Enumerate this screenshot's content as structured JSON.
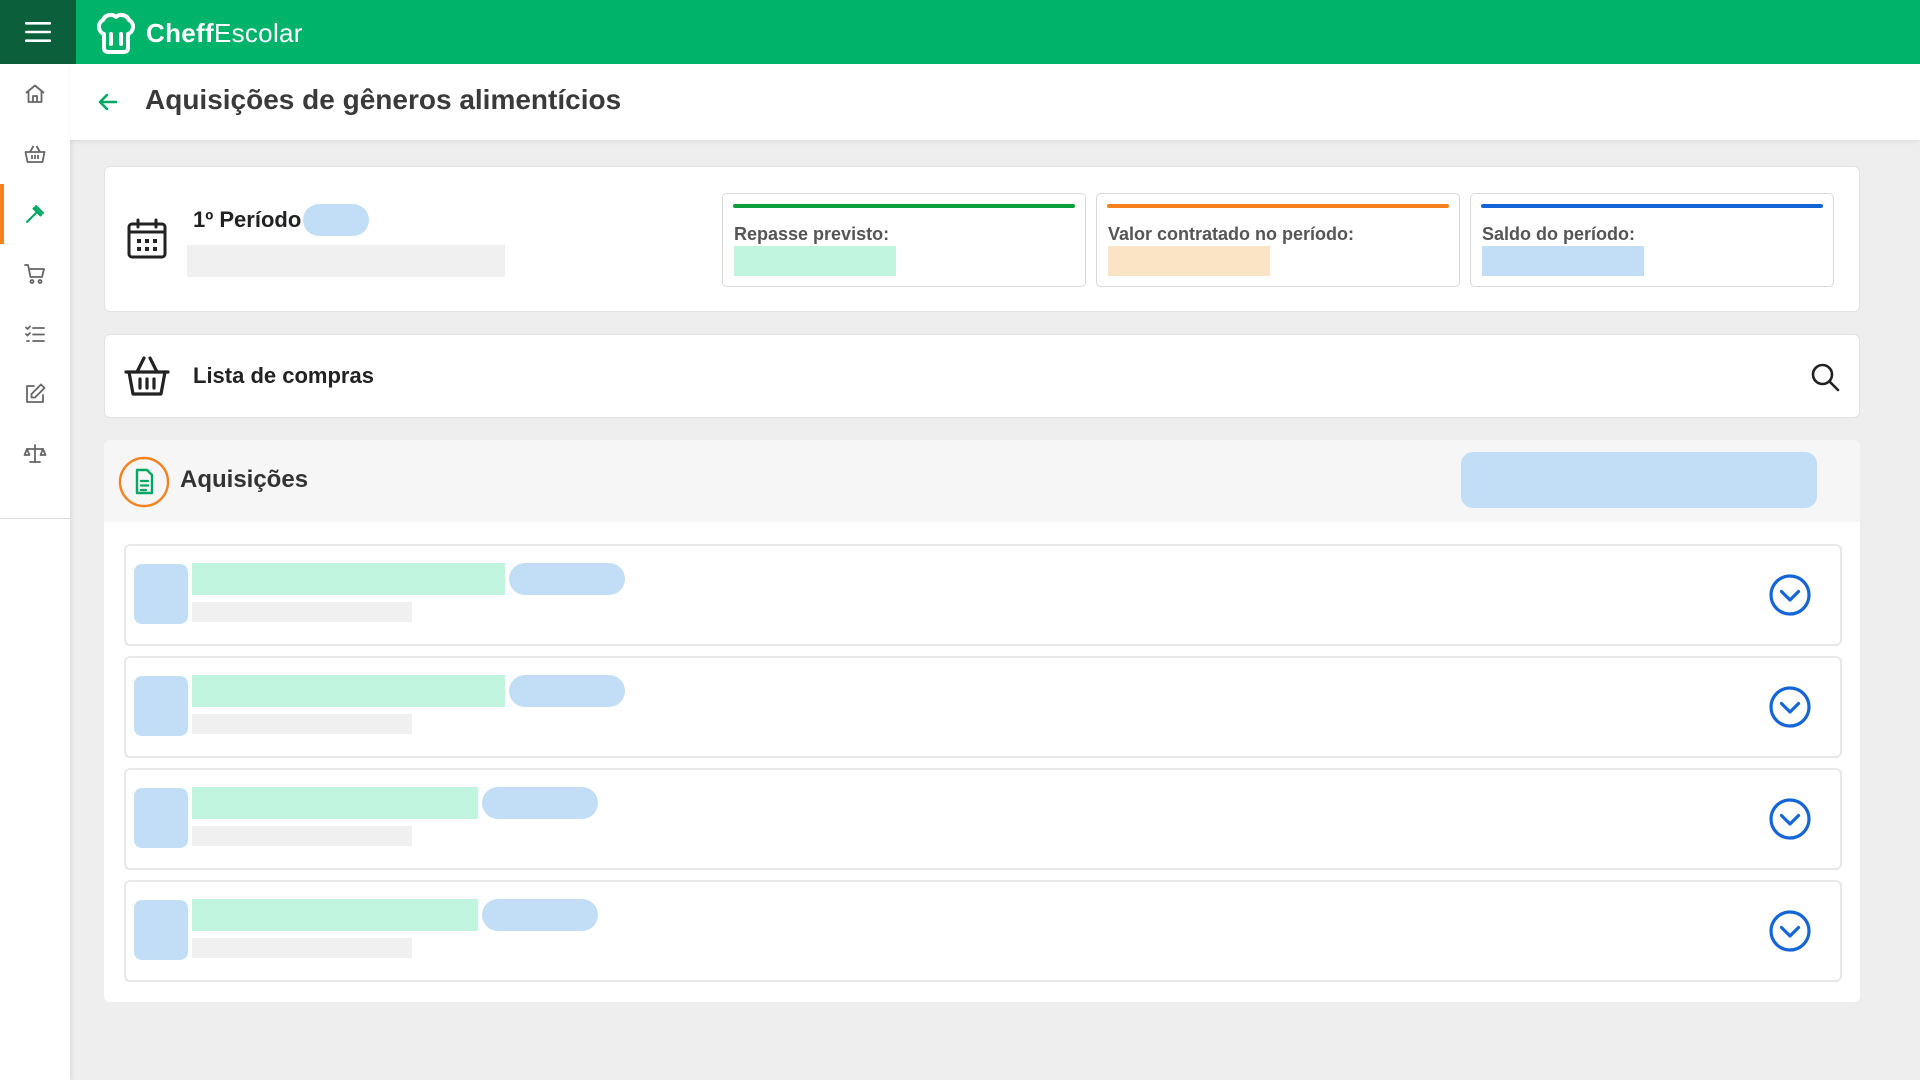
{
  "app": {
    "brand_bold": "Cheff",
    "brand_regular": "Escolar"
  },
  "header": {
    "title": "Aquisições de gêneros alimentícios"
  },
  "sidebar": {
    "items": [
      {
        "icon": "home-icon"
      },
      {
        "icon": "basket-icon"
      },
      {
        "icon": "gavel-icon",
        "active": true
      },
      {
        "icon": "cart-icon"
      },
      {
        "icon": "checklist-icon"
      },
      {
        "icon": "edit-icon"
      },
      {
        "icon": "scale-icon"
      }
    ]
  },
  "period": {
    "label": "1º Período",
    "stats": [
      {
        "label": "Repasse previsto:",
        "color": "#0a9e3c",
        "placeholder_color": "#c1f5df"
      },
      {
        "label": "Valor contratado no período:",
        "color": "#f5821f",
        "placeholder_color": "#fbe3c5"
      },
      {
        "label": "Saldo do período:",
        "color": "#1565d8",
        "placeholder_color": "#c2def7"
      }
    ]
  },
  "shopping_list": {
    "title": "Lista de compras"
  },
  "acquisitions": {
    "title": "Aquisições",
    "items": [
      {
        "title_fraction": 0.178
      },
      {
        "title_fraction": 0.178
      },
      {
        "title_fraction": 0.163
      },
      {
        "title_fraction": 0.163
      }
    ]
  },
  "colors": {
    "brand_green": "#00b36b",
    "brand_dark": "#0c5f3b",
    "accent_orange": "#f5821f",
    "accent_blue": "#1565d8"
  }
}
